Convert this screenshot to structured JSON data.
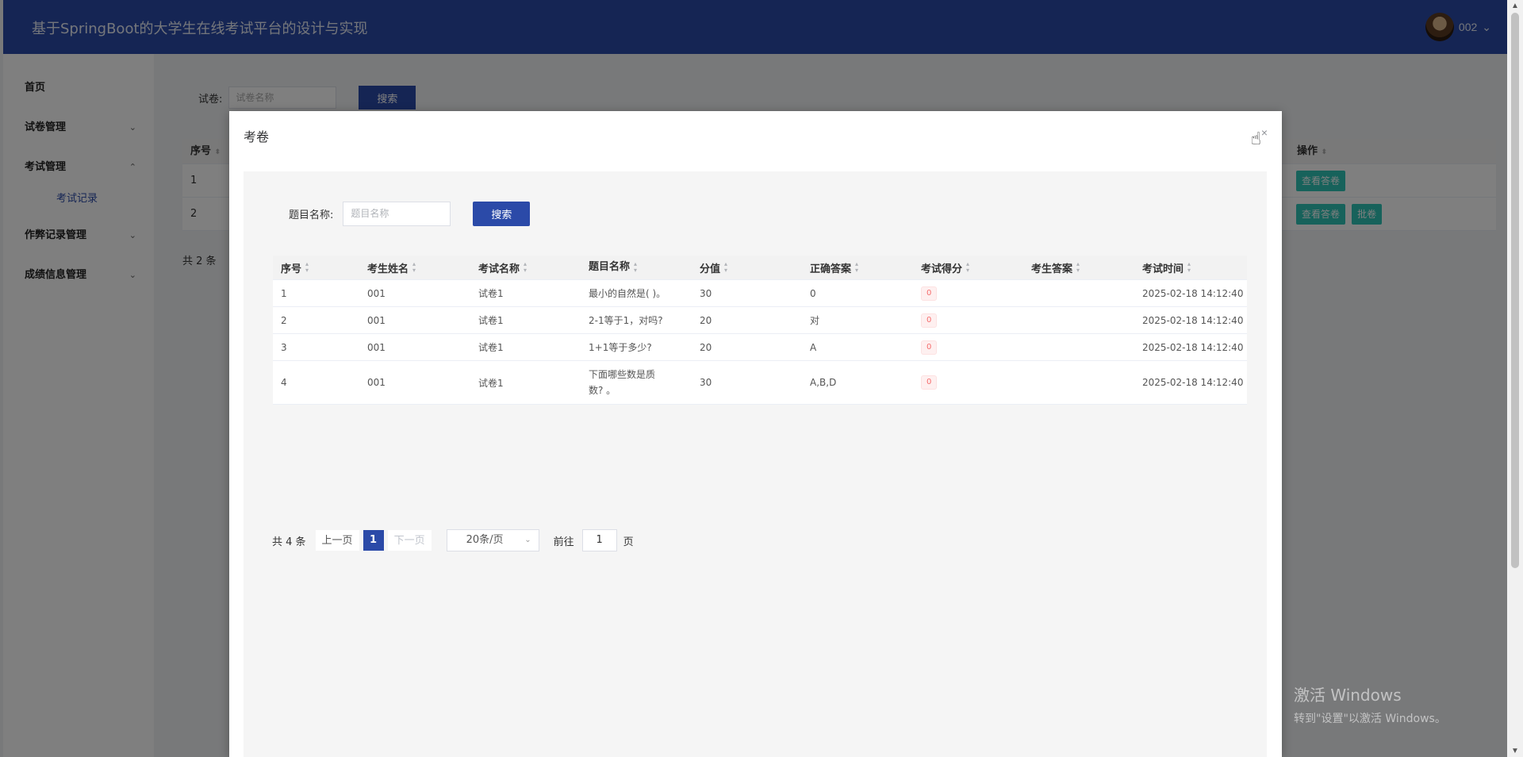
{
  "header": {
    "app_title": "基于SpringBoot的大学生在线考试平台的设计与实现",
    "username": "002"
  },
  "sidebar": {
    "items": [
      {
        "label": "首页"
      },
      {
        "label": "试卷管理"
      },
      {
        "label": "考试管理"
      },
      {
        "label": "作弊记录管理"
      },
      {
        "label": "成绩信息管理"
      }
    ],
    "sub_item": "考试记录"
  },
  "background": {
    "search_label": "试卷:",
    "search_placeholder": "试卷名称",
    "search_button": "搜索",
    "table_headers": {
      "index": "序号",
      "actions": "操作"
    },
    "rows": [
      {
        "index": "1",
        "view_label": "查看答卷"
      },
      {
        "index": "2",
        "view_label": "查看答卷",
        "grade_label": "批卷"
      }
    ],
    "total": "共 2 条"
  },
  "dialog": {
    "title": "考卷",
    "close_icon": "×",
    "search_label": "题目名称:",
    "search_placeholder": "题目名称",
    "search_button": "搜索",
    "headers": [
      "序号",
      "考生姓名",
      "考试名称",
      "题目名称",
      "分值",
      "正确答案",
      "考试得分",
      "考生答案",
      "考试时间"
    ],
    "rows": [
      {
        "index": "1",
        "student": "001",
        "exam": "试卷1",
        "question": "最小的自然是( )。",
        "score": "30",
        "answer": "0",
        "got": "0",
        "student_answer": "",
        "time": "2025-02-18 14:12:40"
      },
      {
        "index": "2",
        "student": "001",
        "exam": "试卷1",
        "question": "2-1等于1，对吗?",
        "score": "20",
        "answer": "对",
        "got": "0",
        "student_answer": "",
        "time": "2025-02-18 14:12:40"
      },
      {
        "index": "3",
        "student": "001",
        "exam": "试卷1",
        "question": "1+1等于多少?",
        "score": "20",
        "answer": "A",
        "got": "0",
        "student_answer": "",
        "time": "2025-02-18 14:12:40"
      },
      {
        "index": "4",
        "student": "001",
        "exam": "试卷1",
        "question": "下面哪些数是质数? 。",
        "score": "30",
        "answer": "A,B,D",
        "got": "0",
        "student_answer": "",
        "time": "2025-02-18 14:12:40"
      }
    ],
    "pagination": {
      "total": "共 4 条",
      "prev": "上一页",
      "current": "1",
      "next": "下一页",
      "page_size": "20条/页",
      "goto_label": "前往",
      "goto_value": "1",
      "page_suffix": "页"
    }
  },
  "watermark": {
    "line1": "激活 Windows",
    "line2": "转到\"设置\"以激活 Windows。"
  },
  "colors": {
    "brand": "#2b4aa8",
    "teal": "#2ec4b6",
    "danger": "#f56c6c"
  }
}
